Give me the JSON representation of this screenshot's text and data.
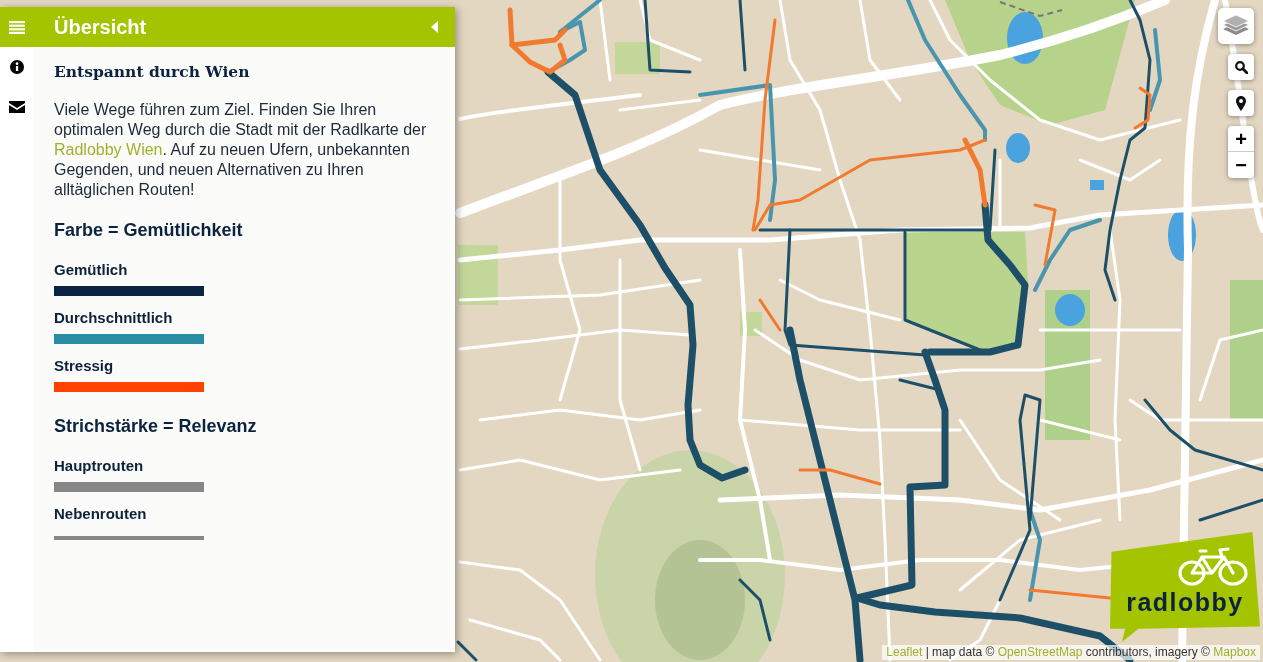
{
  "sidebar": {
    "tabs": [
      {
        "kind": "menu",
        "selected": true
      },
      {
        "kind": "info",
        "selected": false
      },
      {
        "kind": "mail",
        "selected": false
      }
    ],
    "pane": {
      "title": "Übersicht",
      "heading": "Entspannt durch Wien",
      "intro": [
        {
          "kind": "text",
          "text": "Viele Wege führen zum Ziel. Finden Sie Ihren optimalen Weg durch die Stadt mit der Radlkarte der "
        },
        {
          "kind": "link",
          "text": "Radlobby Wien"
        },
        {
          "kind": "text",
          "text": ". Auf zu neuen Ufern, unbekannten Gegenden, und neuen Alternativen zu Ihren alltäglichen Routen!"
        }
      ],
      "legend": [
        {
          "title": "Farbe = Gemütlichkeit",
          "items": [
            {
              "label": "Gemütlich",
              "color": "#0b2240"
            },
            {
              "label": "Durchschnittlich",
              "color": "#2a8ca5"
            },
            {
              "label": "Stressig",
              "color": "#ff4200"
            }
          ]
        },
        {
          "title": "Strichstärke = Relevanz",
          "items": [
            {
              "label": "Hauptrouten",
              "kind": "thick"
            },
            {
              "label": "Nebenrouten",
              "kind": "thin"
            }
          ]
        }
      ]
    }
  },
  "map": {
    "zoom": {
      "in": "+",
      "out": "−"
    },
    "logo": {
      "text": "radlobby"
    },
    "attribution": [
      {
        "kind": "link",
        "text": "Leaflet"
      },
      {
        "kind": "text",
        "text": "| map data ©"
      },
      {
        "kind": "link",
        "text": "OpenStreetMap"
      },
      {
        "kind": "text",
        "text": "contributors, imagery ©"
      },
      {
        "kind": "link",
        "text": "Mapbox"
      }
    ]
  }
}
